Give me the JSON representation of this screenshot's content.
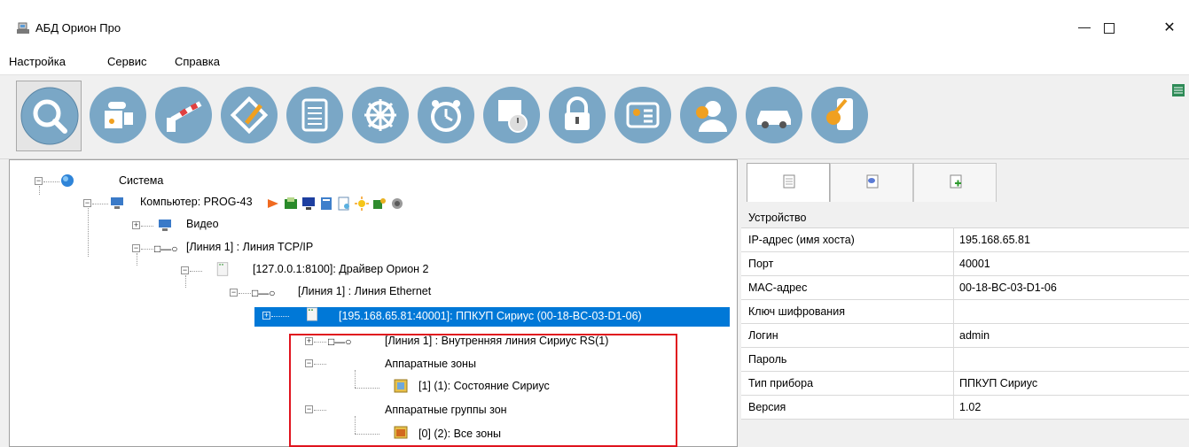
{
  "window": {
    "title": "АБД Орион Про",
    "minimize_icon": "minimize-icon",
    "maximize_icon": "maximize-icon",
    "close_glyph": "✕"
  },
  "menu": {
    "items": [
      "Настройка",
      "Сервис",
      "Справка"
    ]
  },
  "toolbar": {
    "buttons": [
      {
        "icon": "search-icon",
        "active": true
      },
      {
        "icon": "devices-icon"
      },
      {
        "icon": "barrier-icon"
      },
      {
        "icon": "floorplan-icon"
      },
      {
        "icon": "document-list-icon"
      },
      {
        "icon": "wheel-icon"
      },
      {
        "icon": "alarm-clock-icon"
      },
      {
        "icon": "schedule-icon"
      },
      {
        "icon": "lock-icon"
      },
      {
        "icon": "personnel-card-icon"
      },
      {
        "icon": "users-icon"
      },
      {
        "icon": "car-icon"
      },
      {
        "icon": "key-icon"
      }
    ],
    "right_icon": "list-view-icon"
  },
  "tree": {
    "nodes": [
      {
        "label": "Система",
        "expander": "−",
        "icon": "globe-icon"
      },
      {
        "label": "Компьютер: PROG-43",
        "expander": "−",
        "icon": "computer-icon"
      },
      {
        "label": "Видео",
        "expander": "+",
        "icon": "video-monitor-icon"
      },
      {
        "label": "[Линия 1] : Линия TCP/IP",
        "expander": "−",
        "icon": "line-icon",
        "glyph": "□—○"
      },
      {
        "label": "[127.0.0.1:8100]: Драйвер Орион 2",
        "expander": "−",
        "icon": "driver-icon"
      },
      {
        "label": "[Линия 1] : Линия Ethernet",
        "expander": "−",
        "icon": "line-icon",
        "glyph": "□—○"
      },
      {
        "label": "[195.168.65.81:40001]: ППКУП Сириус (00-18-BC-03-D1-06)",
        "expander": "+",
        "icon": "device-icon",
        "selected": true
      },
      {
        "label": "[Линия 1] : Внутренняя линия Сириус RS(1)",
        "expander": "+",
        "icon": "line-icon",
        "glyph": "□—○"
      },
      {
        "label": "Аппаратные зоны",
        "expander": "−",
        "icon": ""
      },
      {
        "label": "[1] (1): Состояние Сириус",
        "expander": "",
        "icon": "zone-icon"
      },
      {
        "label": "Аппаратные группы зон",
        "expander": "−",
        "icon": ""
      },
      {
        "label": "[0] (2): Все зоны",
        "expander": "",
        "icon": "zone-group-icon"
      }
    ],
    "computer_status_icons": [
      "arrow-icon",
      "save-icon",
      "monitor-icon",
      "server-icon",
      "report-icon",
      "sun-icon",
      "key-folder-icon",
      "speaker-icon"
    ]
  },
  "properties": {
    "tabs": [
      {
        "icon": "document-tab-icon",
        "active": true
      },
      {
        "icon": "comment-tab-icon"
      },
      {
        "icon": "add-document-tab-icon"
      }
    ],
    "section": "Устройство",
    "rows": [
      {
        "key": "IP-адрес (имя хоста)",
        "value": "195.168.65.81"
      },
      {
        "key": "Порт",
        "value": "40001"
      },
      {
        "key": "MAC-адрес",
        "value": "00-18-BC-03-D1-06"
      },
      {
        "key": "Ключ шифрования",
        "value": ""
      },
      {
        "key": "Логин",
        "value": "admin"
      },
      {
        "key": "Пароль",
        "value": ""
      },
      {
        "key": "Тип прибора",
        "value": "ППКУП Сириус"
      },
      {
        "key": "Версия",
        "value": "1.02"
      }
    ]
  },
  "colors": {
    "selection": "#0078d7",
    "highlight_border": "#e0141e",
    "toolbar_circle": "#7aa7c6"
  }
}
